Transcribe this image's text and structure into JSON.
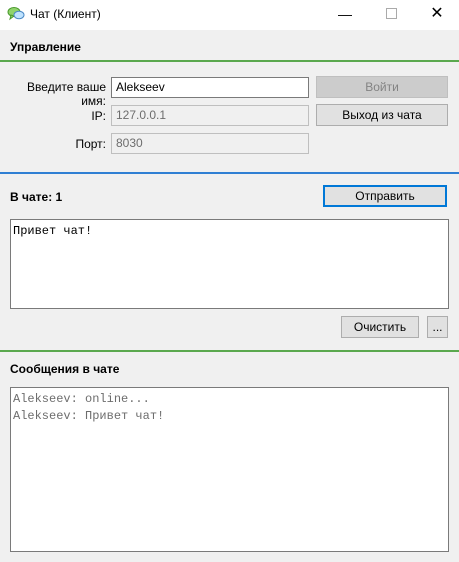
{
  "window": {
    "title": "Чат (Клиент)",
    "icon": "chat-bubbles-icon",
    "controls": {
      "minimize": "—",
      "close": "✕"
    }
  },
  "colors": {
    "section_green": "#5aa84e",
    "section_blue": "#2f7fd3",
    "accent": "#0078d7"
  },
  "control": {
    "title": "Управление",
    "name_label": "Введите ваше имя:",
    "name_value": "Alekseev",
    "ip_label": "IP:",
    "ip_value": "127.0.0.1",
    "port_label": "Порт:",
    "port_value": "8030",
    "login_button": "Войти",
    "logout_button": "Выход из чата"
  },
  "compose": {
    "title": "В чате: 1",
    "send_button": "Отправить",
    "message_text": "Привет чат!",
    "clear_button": "Очистить",
    "more_button": "..."
  },
  "messages": {
    "title": "Сообщения в чате",
    "lines": [
      "Alekseev: online...",
      "Alekseev: Привет чат!"
    ]
  }
}
